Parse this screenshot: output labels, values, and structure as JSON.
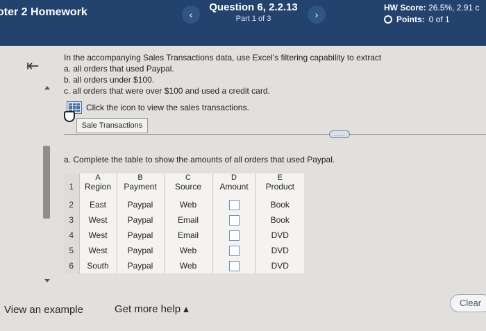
{
  "header": {
    "assignment_title": "oter 2 Homework",
    "question_title": "Question 6, 2.2.13",
    "question_part": "Part 1 of 3",
    "prev_icon": "‹",
    "next_icon": "›",
    "hw_score_label": "HW Score:",
    "hw_score_value": "26.5%, 2.91 c",
    "points_label": "Points:",
    "points_value": "0 of 1",
    "colors": {
      "bar": "#23436e"
    }
  },
  "question": {
    "intro": "In the accompanying Sales Transactions data, use Excel's filtering capability to extract",
    "items": [
      "a. all orders that used Paypal.",
      "b. all orders under $100.",
      "c. all orders that were over $100 and used a credit card."
    ],
    "icon_prompt": "Click the icon to view the sales transactions.",
    "sales_button": "Sale Transactions",
    "more_label": "....."
  },
  "part_a": {
    "instruction": "a. Complete the table to show the amounts of all orders that used Paypal."
  },
  "sheet": {
    "col_letters": [
      "A",
      "B",
      "C",
      "D",
      "E"
    ],
    "headers": [
      "Region",
      "Payment",
      "Source",
      "Amount",
      "Product"
    ],
    "row_numbers": [
      "1",
      "2",
      "3",
      "4",
      "5",
      "6"
    ],
    "rows": [
      [
        "East",
        "Paypal",
        "Web",
        "",
        "Book"
      ],
      [
        "West",
        "Paypal",
        "Email",
        "",
        "Book"
      ],
      [
        "West",
        "Paypal",
        "Email",
        "",
        "DVD"
      ],
      [
        "West",
        "Paypal",
        "Web",
        "",
        "DVD"
      ],
      [
        "South",
        "Paypal",
        "Web",
        "",
        "DVD"
      ]
    ]
  },
  "footer": {
    "view_example": "View an example",
    "get_help": "Get more help ▴",
    "clear": "Clear"
  },
  "icons": {
    "collapse": "collapse-panel-icon",
    "data_table": "data-table-icon"
  }
}
